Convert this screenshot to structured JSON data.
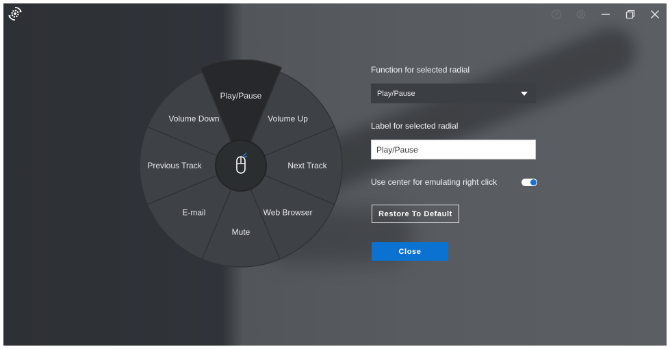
{
  "titlebar": {
    "app_icon": "gear-cycle-icon",
    "buttons": [
      {
        "name": "help-icon"
      },
      {
        "name": "settings-icon"
      },
      {
        "name": "minimize-icon"
      },
      {
        "name": "restore-icon"
      },
      {
        "name": "close-icon"
      }
    ]
  },
  "radial": {
    "center_icon": "mouse-icon",
    "segments": [
      {
        "label": "Play/Pause",
        "selected": true
      },
      {
        "label": "Volume Up"
      },
      {
        "label": "Next Track"
      },
      {
        "label": "Web Browser"
      },
      {
        "label": "Mute"
      },
      {
        "label": "E-mail"
      },
      {
        "label": "Previous Track"
      },
      {
        "label": "Volume Down"
      }
    ]
  },
  "settings": {
    "function_label": "Function for selected radial",
    "function_value": "Play/Pause",
    "label_label": "Label for selected radial",
    "label_value": "Play/Pause",
    "center_label": "Use center for emulating right click",
    "center_enabled": true,
    "restore_label": "Restore To Default",
    "close_label": "Close"
  },
  "colors": {
    "accent": "#0b72d1",
    "segment": "#3e4146",
    "segment_selected": "#26282b"
  }
}
